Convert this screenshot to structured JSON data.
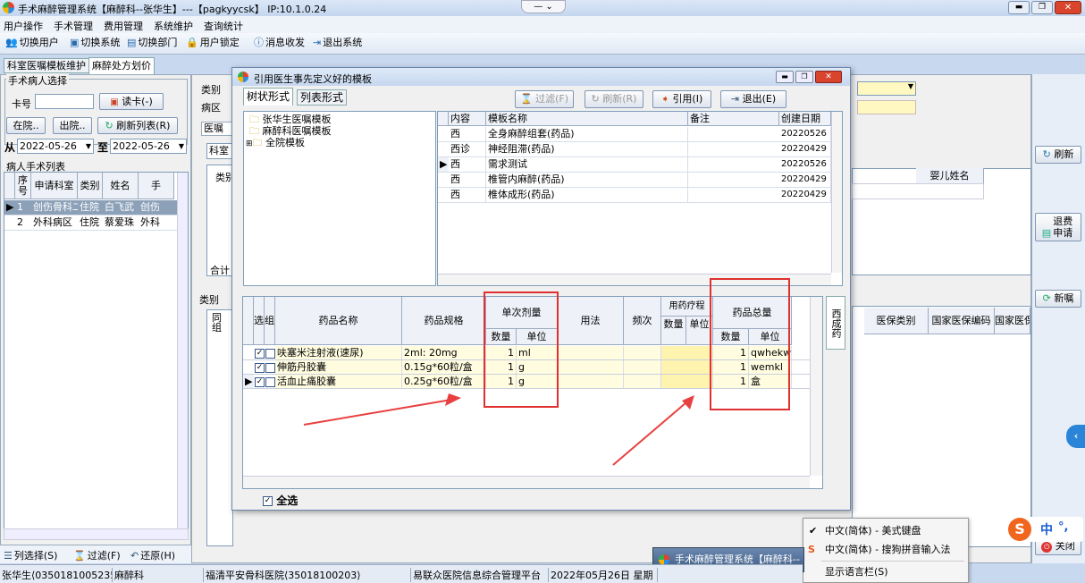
{
  "app": {
    "title": "手术麻醉管理系统【麻醉科--张华生】---【pagkyycsk】 IP:10.1.0.24"
  },
  "menu": [
    "用户操作",
    "手术管理",
    "费用管理",
    "系统维护",
    "查询统计"
  ],
  "toolbar": [
    "切换用户",
    "切换系统",
    "切换部门",
    "用户锁定",
    "消息收发",
    "退出系统"
  ],
  "tabs": [
    "科室医嘱模板维护",
    "麻醉处方划价"
  ],
  "left": {
    "group_title": "手术病人选择",
    "card_label": "卡号",
    "read_card": "读卡(-)",
    "inhosp": "在院..",
    "outhosp": "出院..",
    "refresh": "刷新列表(R)",
    "from_label": "从",
    "date_from": "2022-05-26",
    "to_label": "至",
    "date_to": "2022-05-26",
    "list_title": "病人手术列表",
    "cols": [
      "序号",
      "申请科室",
      "类别",
      "姓名",
      "手"
    ],
    "rows": [
      [
        "1",
        "创伤骨科二",
        "住院",
        "白飞武",
        "创伤"
      ],
      [
        "2",
        "外科病区",
        "住院",
        "蔡爱珠",
        "外科"
      ]
    ],
    "bottom": [
      "列选择(S)",
      "过滤(F)",
      "还原(H)"
    ]
  },
  "mid": {
    "type_label": "类别",
    "ward_label": "病区",
    "tab_orders": "医嘱",
    "tab_dept": "科室",
    "col_type": "类别",
    "total": "合计",
    "type2": "类别",
    "group_label": "同组",
    "col_baby": "婴儿姓名",
    "cols_right": [
      "医保类别",
      "国家医保编码",
      "国家医保"
    ]
  },
  "right_buttons": [
    "刷新",
    "退费申请",
    "新嘱",
    "关闭"
  ],
  "dialog": {
    "title": "引用医生事先定义好的模板",
    "tab_tree": "树状形式",
    "tab_list": "列表形式",
    "btn_filter": "过滤(F)",
    "btn_refresh": "刷新(R)",
    "btn_ref": "引用(I)",
    "btn_exit": "退出(E)",
    "tree": [
      "张华生医嘱模板",
      "麻醉科医嘱模板",
      "全院模板"
    ],
    "tpl_cols": [
      "内容",
      "模板名称",
      "备注",
      "创建日期"
    ],
    "tpl_rows": [
      [
        "西",
        "全身麻醉组套(药品)",
        "",
        "20220526"
      ],
      [
        "西诊",
        "神经阻滞(药品)",
        "",
        "20220429"
      ],
      [
        "西",
        "需求测试",
        "",
        "20220526"
      ],
      [
        "西",
        "椎管内麻醉(药品)",
        "",
        "20220429"
      ],
      [
        "西",
        "椎体成形(药品)",
        "",
        "20220429"
      ]
    ],
    "drug_cols": {
      "sel": "选",
      "grp": "组",
      "name": "药品名称",
      "spec": "药品规格",
      "single": "单次剂量",
      "qty": "数量",
      "unit": "单位",
      "usage": "用法",
      "freq": "频次",
      "course": "用药疗程",
      "cqty": "数量",
      "cunit": "单位",
      "total": "药品总量",
      "tqty": "数量",
      "tunit": "单位"
    },
    "drugs": [
      [
        "呋塞米注射液(速尿)",
        "2ml: 20mg",
        "1",
        "ml",
        "1",
        "qwhekw"
      ],
      [
        "伸筋丹胶囊",
        "0.15g*60粒/盒",
        "1",
        "g",
        "1",
        "wemkl"
      ],
      [
        "活血止痛胶囊",
        "0.25g*60粒/盒",
        "1",
        "g",
        "1",
        "盒"
      ]
    ],
    "side_tab": "西成药",
    "select_all": "全选"
  },
  "ime": {
    "item1": "中文(简体) - 美式键盘",
    "item2": "中文(简体) - 搜狗拼音输入法",
    "item3": "显示语言栏(S)",
    "ch": "中",
    "punc": "°,"
  },
  "task": "手术麻醉管理系统【麻醉科--",
  "status": [
    "张华生⟨0350181005235⟩",
    "麻醉科",
    "福清平安骨科医院⟨35018100203⟩",
    "易联众医院信息综合管理平台",
    "2022年05月26日 星期"
  ]
}
